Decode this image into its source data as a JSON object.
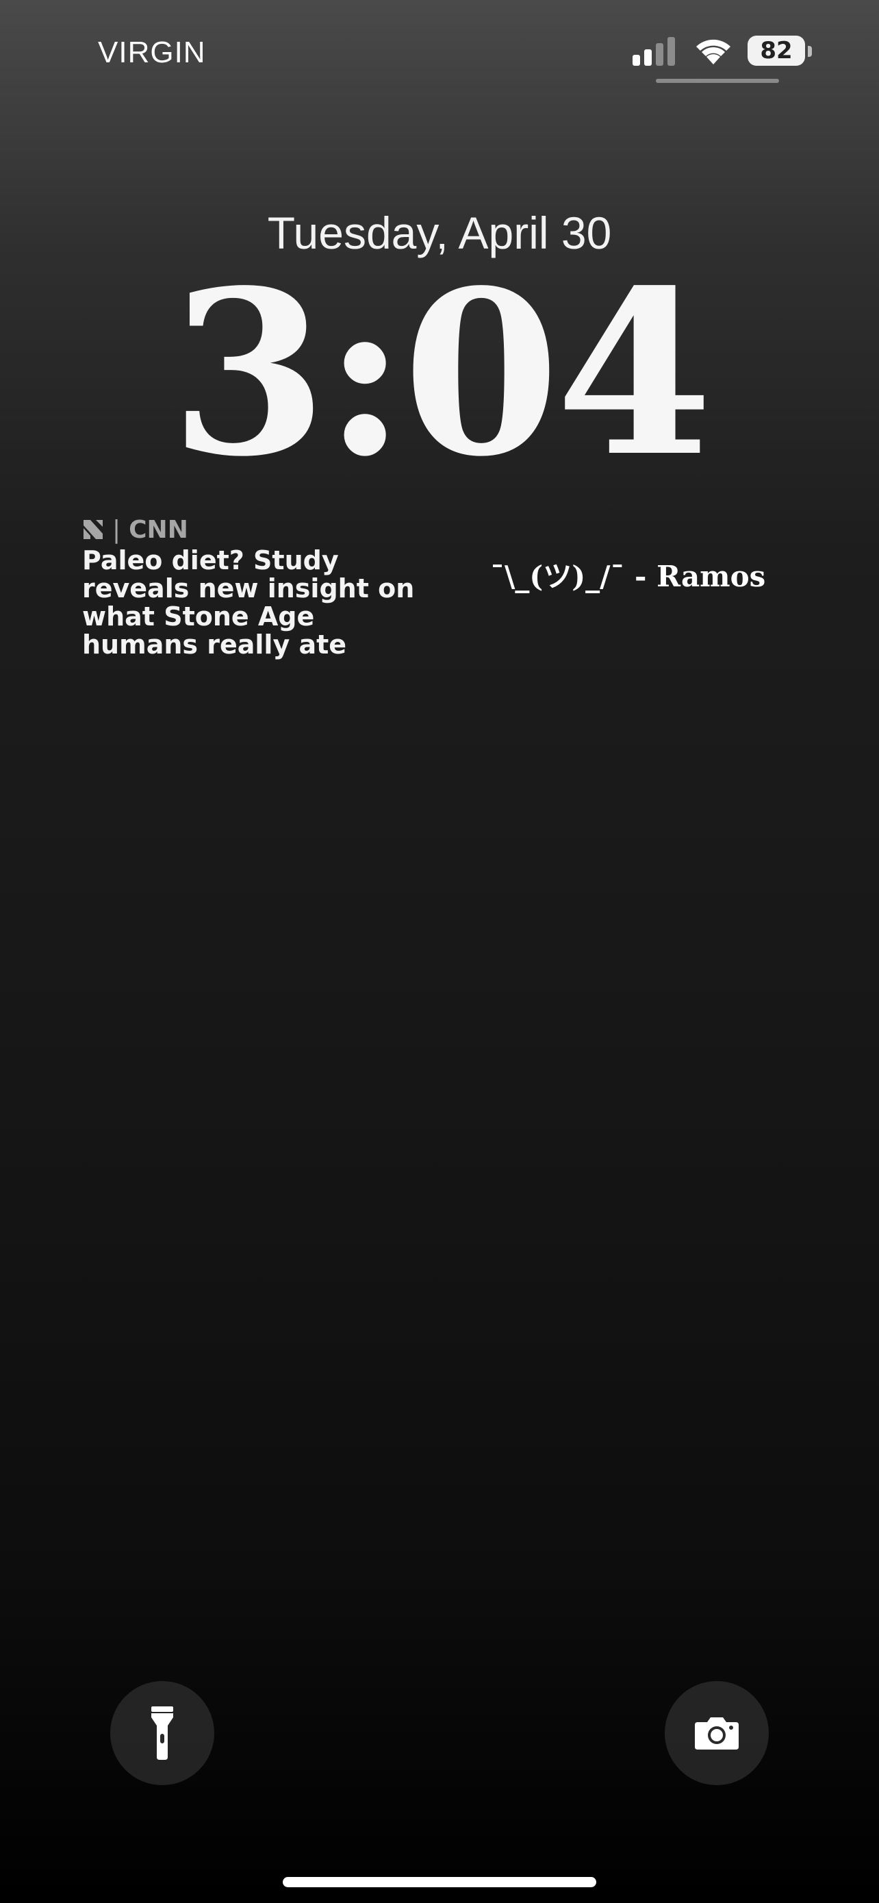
{
  "status_bar": {
    "carrier": "VIRGIN",
    "battery_level": "82",
    "signal_icon": "cellular-signal-icon",
    "wifi_icon": "wifi-icon",
    "battery_icon": "battery-icon"
  },
  "lock_screen": {
    "date": "Tuesday, April 30",
    "time": "3:04"
  },
  "widgets": {
    "news": {
      "source": "CNN",
      "separator": "|",
      "logo_icon": "apple-news-icon",
      "headline": "Paleo diet? Study reveals new insight on what Stone Age humans really ate"
    },
    "quote": {
      "text": "¯\\_(ツ)_/¯ - Ramos"
    }
  },
  "quick_actions": {
    "left_icon": "flashlight-icon",
    "right_icon": "camera-icon"
  },
  "colors": {
    "text_primary": "#f4f4f4",
    "text_secondary": "#a6a6a6",
    "button_bg": "#3c3c3c"
  }
}
